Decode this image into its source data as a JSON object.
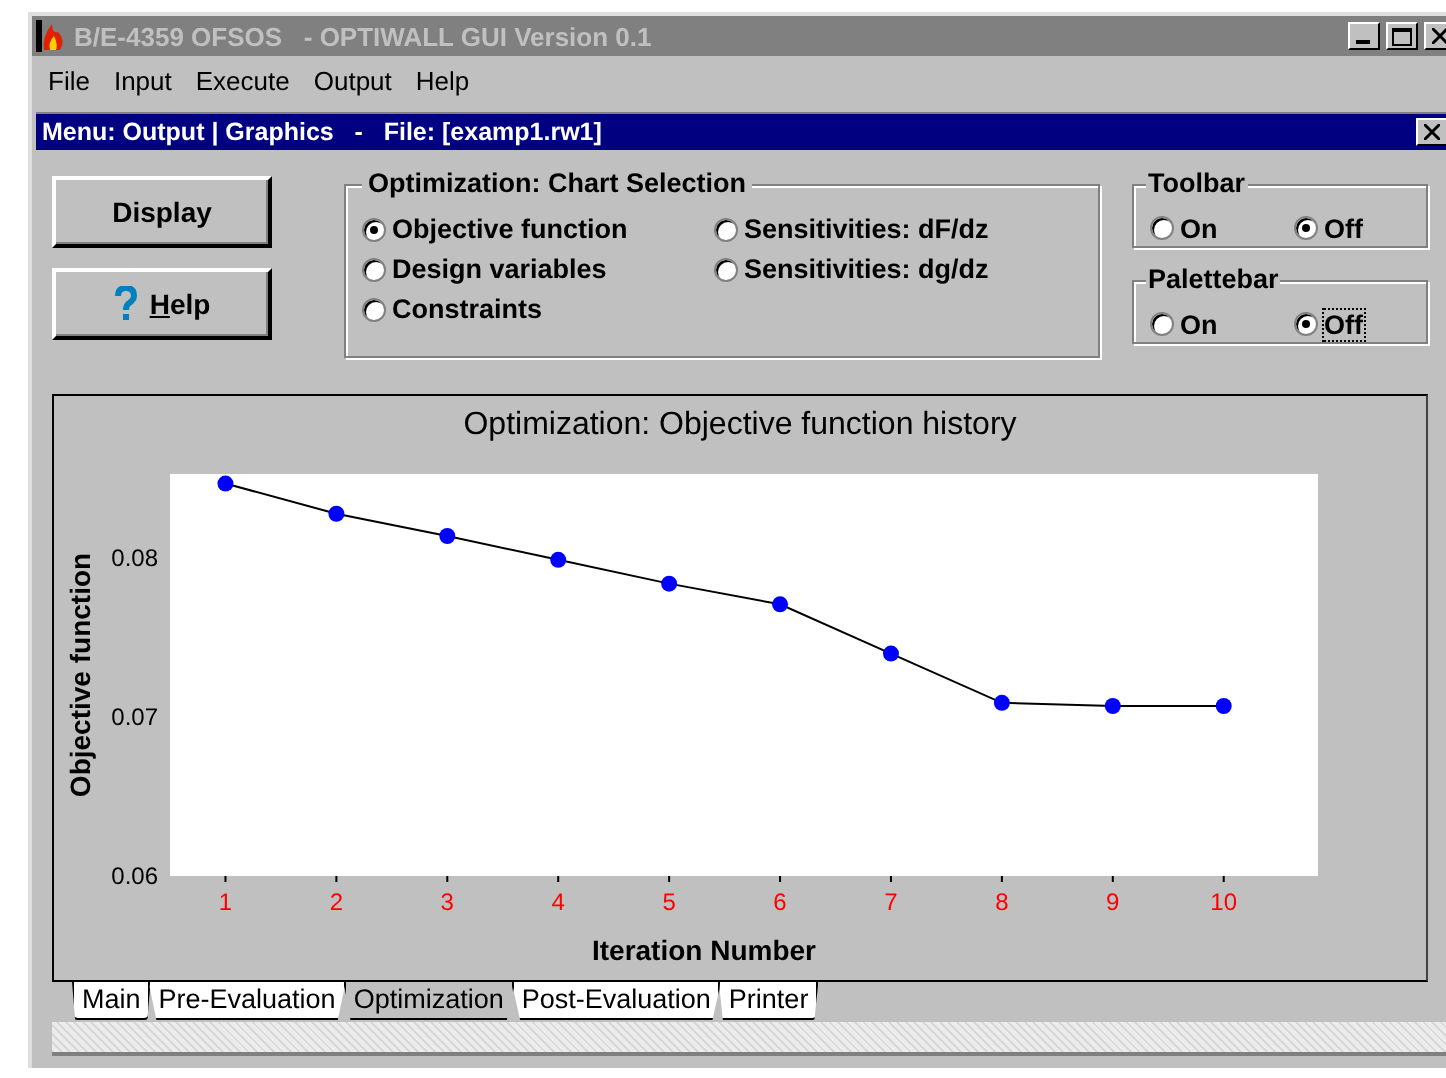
{
  "window": {
    "title": "B/E-4359 OFSOS   - OPTIWALL GUI Version 0.1"
  },
  "menu_bar": [
    "File",
    "Input",
    "Execute",
    "Output",
    "Help"
  ],
  "child_window": {
    "title": "Menu: Output | Graphics   -   File: [examp1.rw1]"
  },
  "buttons": [
    {
      "label": "Display",
      "kind": "plain",
      "first_letter_underlined": false
    },
    {
      "label": "Help",
      "kind": "help",
      "first_letter_underlined": true
    }
  ],
  "chart_selection": {
    "title": "Optimization: Chart Selection",
    "options": [
      {
        "label": "Objective function",
        "selected": true
      },
      {
        "label": "Sensitivities: dF/dz",
        "selected": false
      },
      {
        "label": "Design variables",
        "selected": false
      },
      {
        "label": "Sensitivities: dg/dz",
        "selected": false
      },
      {
        "label": "Constraints",
        "selected": false
      }
    ]
  },
  "toolbar": {
    "title": "Toolbar",
    "options": [
      {
        "label": "On",
        "selected": false,
        "focused": false
      },
      {
        "label": "Off",
        "selected": true,
        "focused": false
      }
    ]
  },
  "palettebar": {
    "title": "Palettebar",
    "options": [
      {
        "label": "On",
        "selected": false,
        "focused": false
      },
      {
        "label": "Off",
        "selected": true,
        "focused": true
      }
    ]
  },
  "chart": {
    "chart_data": {
      "type": "line",
      "title": "Optimization: Objective function history",
      "xlabel": "Iteration Number",
      "ylabel": "Objective function",
      "x": [
        1,
        2,
        3,
        4,
        5,
        6,
        7,
        8,
        9,
        10
      ],
      "series": [
        {
          "color": "#0000ff",
          "marker": "circle",
          "values": [
            0.0847,
            0.0828,
            0.0814,
            0.0799,
            0.0784,
            0.0771,
            0.074,
            0.0709,
            0.0707,
            0.0707
          ]
        }
      ],
      "xlim": [
        0.5,
        10.85
      ],
      "ylim": [
        0.06,
        0.0853
      ],
      "xticks": [
        1,
        2,
        3,
        4,
        5,
        6,
        7,
        8,
        9,
        10
      ],
      "yticks": [
        0.06,
        0.07,
        0.08
      ]
    }
  },
  "tabs": [
    {
      "label": "Main",
      "selected": false
    },
    {
      "label": "Pre-Evaluation",
      "selected": false
    },
    {
      "label": "Optimization",
      "selected": true
    },
    {
      "label": "Post-Evaluation",
      "selected": false
    },
    {
      "label": "Printer",
      "selected": false
    }
  ]
}
